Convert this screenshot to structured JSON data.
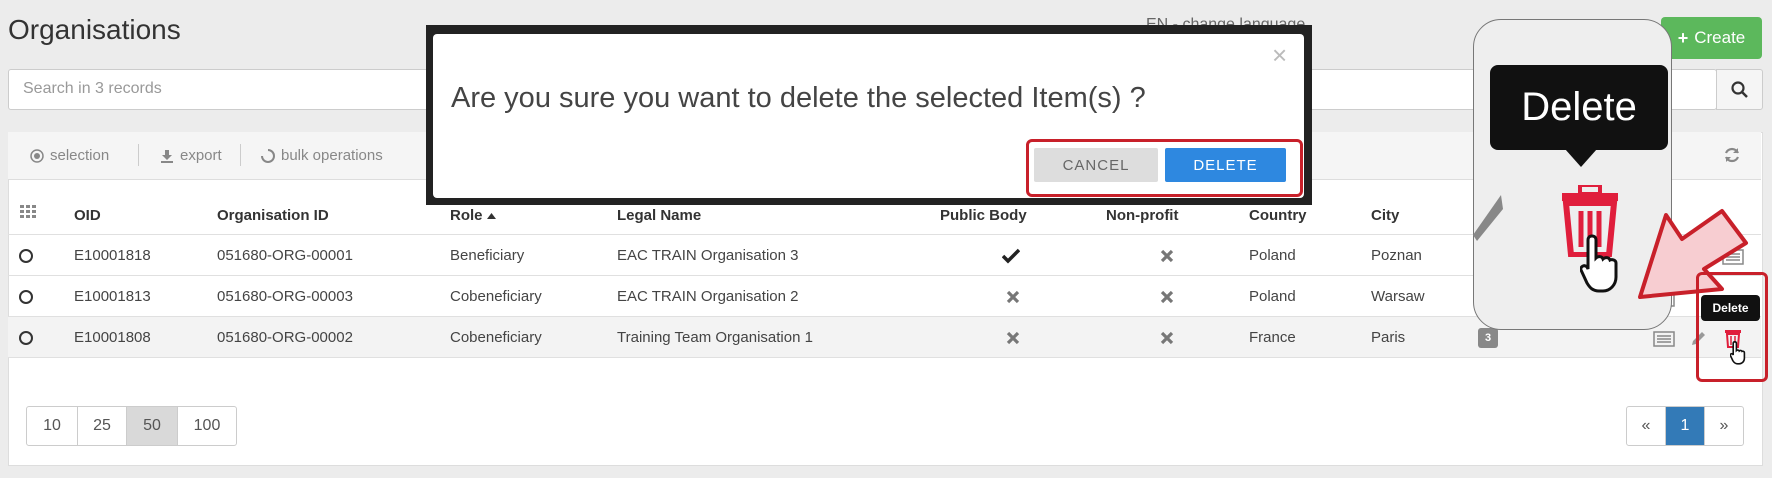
{
  "page": {
    "title": "Organisations",
    "create_label": "Create",
    "search_placeholder": "Search in 3 records",
    "language_text": "EN - change language"
  },
  "toolbar": {
    "selection": "selection",
    "export": "export",
    "bulk": "bulk operations"
  },
  "table": {
    "headers": {
      "oid": "OID",
      "org_id": "Organisation ID",
      "role": "Role",
      "legal": "Legal Name",
      "public": "Public Body",
      "nonprofit": "Non-profit",
      "country": "Country",
      "city": "City"
    },
    "rows": [
      {
        "oid": "E10001818",
        "org_id": "051680-ORG-00001",
        "role": "Beneficiary",
        "legal": "EAC TRAIN Organisation 3",
        "public": "check",
        "nonprofit": "cross",
        "country": "Poland",
        "city": "Poznan"
      },
      {
        "oid": "E10001813",
        "org_id": "051680-ORG-00003",
        "role": "Cobeneficiary",
        "legal": "EAC TRAIN Organisation 2",
        "public": "cross",
        "nonprofit": "cross",
        "country": "Poland",
        "city": "Warsaw"
      },
      {
        "oid": "E10001808",
        "org_id": "051680-ORG-00002",
        "role": "Cobeneficiary",
        "legal": "Training Team Organisation 1",
        "public": "cross",
        "nonprofit": "cross",
        "country": "France",
        "city": "Paris",
        "badge": "3"
      }
    ]
  },
  "pagination": {
    "sizes": [
      "10",
      "25",
      "50",
      "100"
    ],
    "active_size": "50",
    "prev": "«",
    "current": "1",
    "next": "»"
  },
  "modal": {
    "message": "Are you sure you want to delete the selected Item(s) ?",
    "close": "×",
    "cancel": "CANCEL",
    "delete": "DELETE"
  },
  "tooltip": {
    "big": "Delete",
    "small": "Delete"
  },
  "colors": {
    "create": "#5cb85c",
    "delete_button": "#2e88e0",
    "highlight": "#c8202a",
    "pager_active": "#337ab7"
  }
}
